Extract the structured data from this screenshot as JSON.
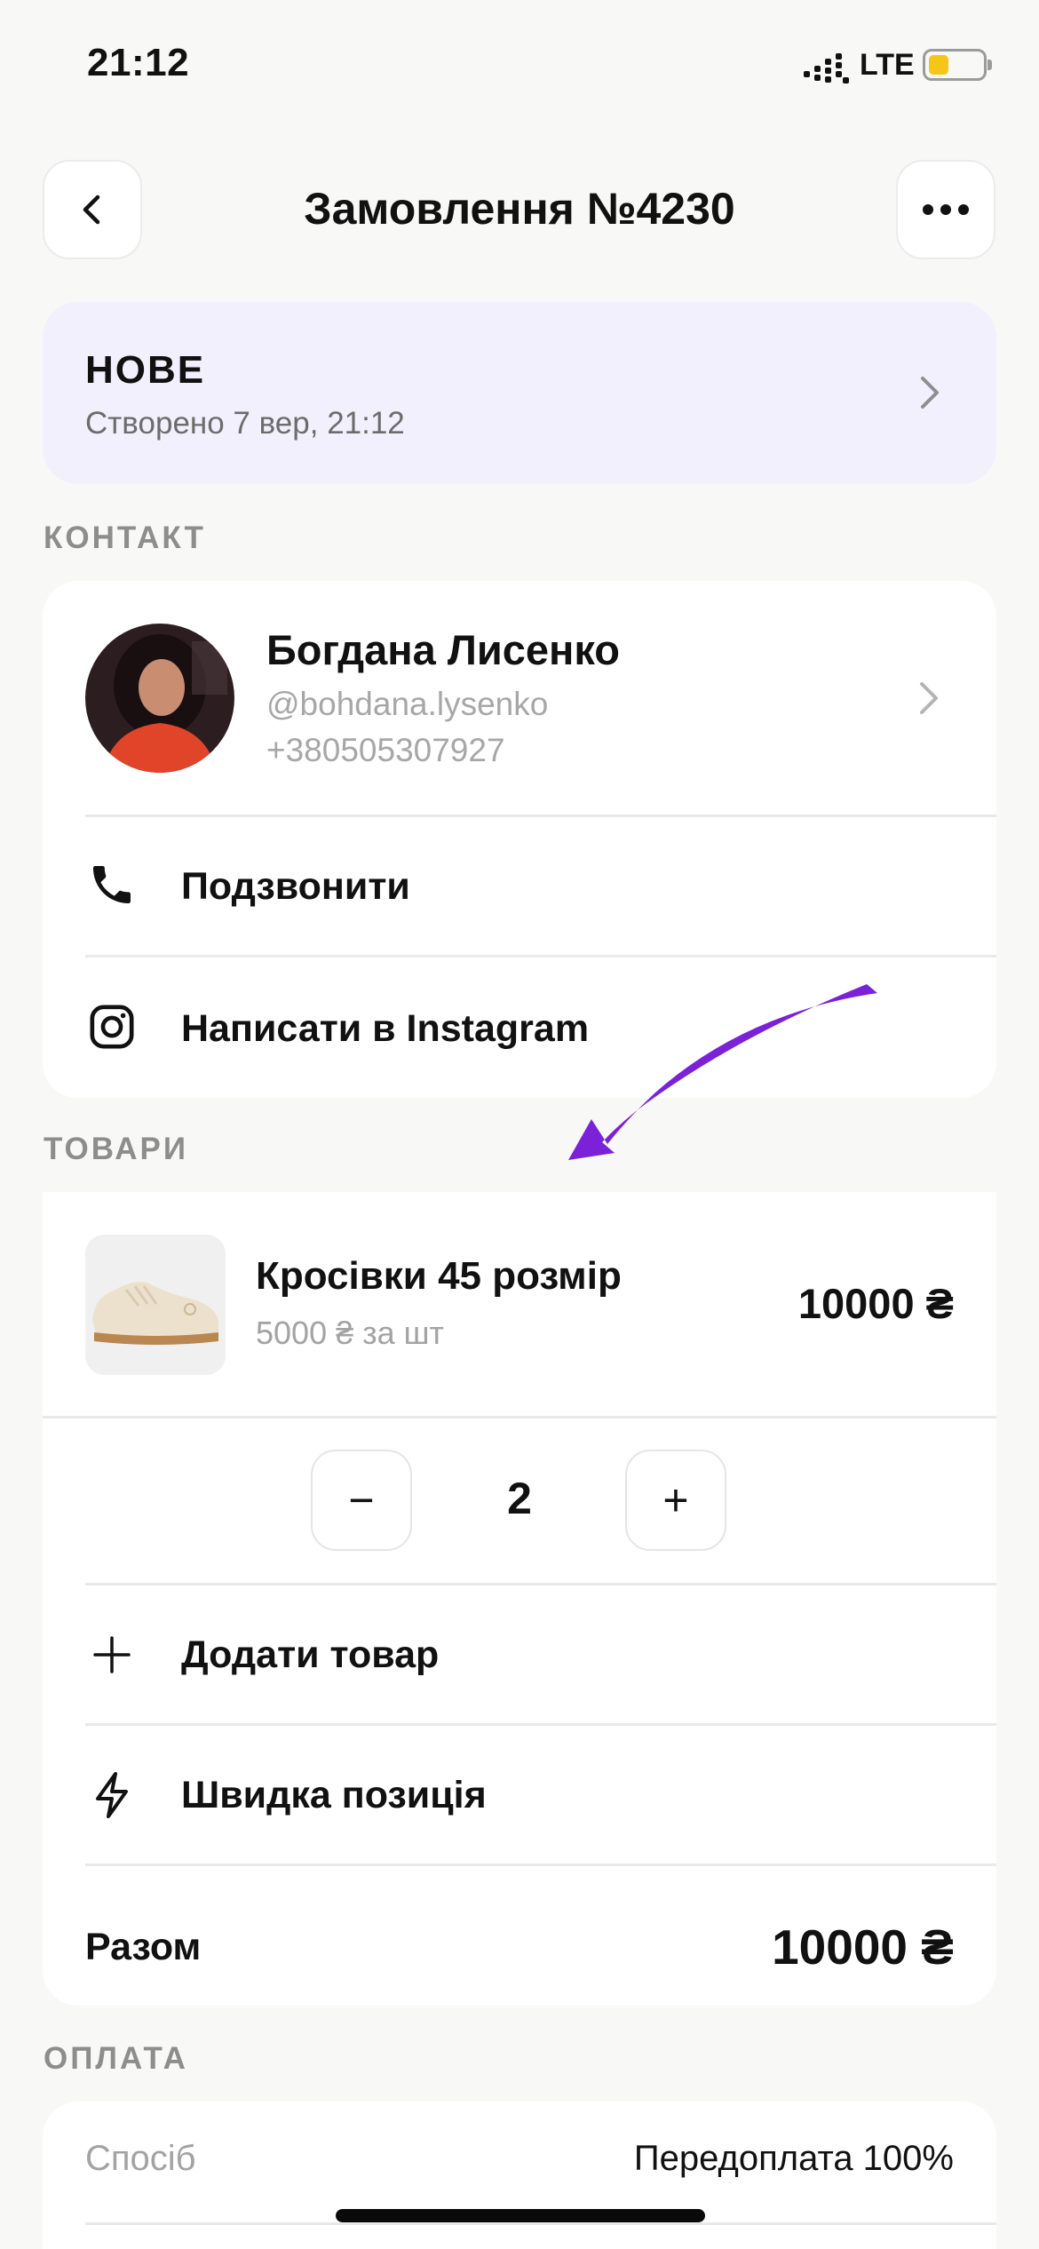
{
  "status_bar": {
    "time": "21:12",
    "network": "LTE",
    "battery_level": 0.38,
    "battery_color": "#f5c518"
  },
  "header": {
    "title": "Замовлення №4230",
    "back_icon": "chevron-left-icon",
    "more_icon": "ellipsis-icon"
  },
  "order_status": {
    "title": "НОВЕ",
    "created": "Створено 7 вер, 21:12",
    "background": "#f2f0fd"
  },
  "contact": {
    "section_label": "КОНТАКТ",
    "name": "Богдана Лисенко",
    "handle": "@bohdana.lysenko",
    "phone": "+380505307927",
    "call_label": "Подзвонити",
    "instagram_label": "Написати в Instagram"
  },
  "products": {
    "section_label": "ТОВАРИ",
    "items": [
      {
        "name": "Кросівки 45 розмір",
        "unit_price": "5000 ₴ за шт",
        "line_total": "10000 ₴",
        "quantity": "2"
      }
    ],
    "decrement_label": "−",
    "increment_label": "+",
    "add_product_label": "Додати товар",
    "quick_item_label": "Швидка позиція",
    "total_label": "Разом",
    "total_value": "10000 ₴"
  },
  "payment": {
    "section_label": "ОПЛАТА",
    "method_label": "Спосіб",
    "method_value": "Передоплата 100%"
  },
  "colors": {
    "background": "#f8f8f7",
    "annotation_arrow": "#7b22d8",
    "muted_text": "#a3a3a3"
  }
}
